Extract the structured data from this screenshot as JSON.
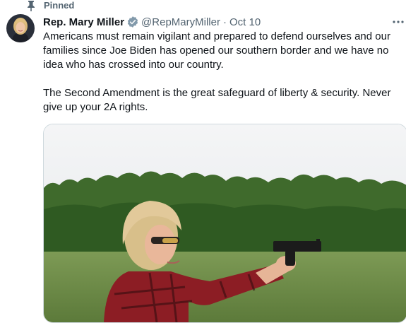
{
  "pinned": {
    "label": "Pinned",
    "icon": "pin-icon"
  },
  "tweet": {
    "author_name": "Rep. Mary Miller",
    "verified_icon": "verified-badge-icon",
    "handle": "@RepMaryMiller",
    "separator": "·",
    "date": "Oct 10",
    "paragraphs": [
      "Americans must remain vigilant and prepared to defend ourselves and our families since Joe Biden has opened our southern border and we have no idea who has crossed into our country.",
      "The Second Amendment is the great safeguard of liberty & security. Never give up your 2A rights."
    ],
    "more_icon": "more-options-icon"
  },
  "colors": {
    "text": "#0f1419",
    "secondary": "#536471",
    "verified": "#829aab",
    "border": "#cfd9de"
  }
}
